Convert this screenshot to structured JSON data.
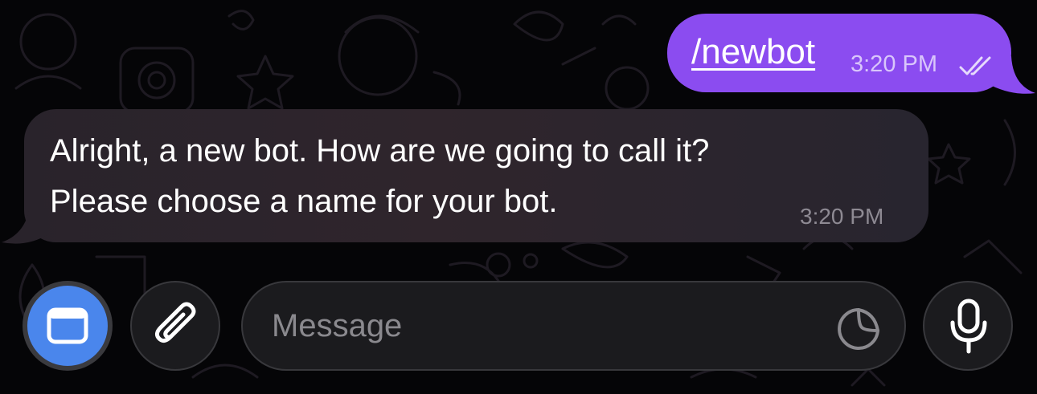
{
  "chat": {
    "outgoing": {
      "text": "/newbot",
      "time": "3:20 PM",
      "status_icon": "double-check-read-icon",
      "bubble_color": "#8b4cf0"
    },
    "incoming": {
      "lines": [
        "Alright, a new bot. How are we going to call it?",
        "Please choose a name for your bot."
      ],
      "time": "3:20 PM"
    }
  },
  "composer": {
    "placeholder": "Message",
    "app_button_icon": "window-icon",
    "app_button_color": "#4a86ec",
    "attach_icon": "paperclip-icon",
    "sticker_icon": "sticker-icon",
    "mic_icon": "microphone-icon"
  }
}
